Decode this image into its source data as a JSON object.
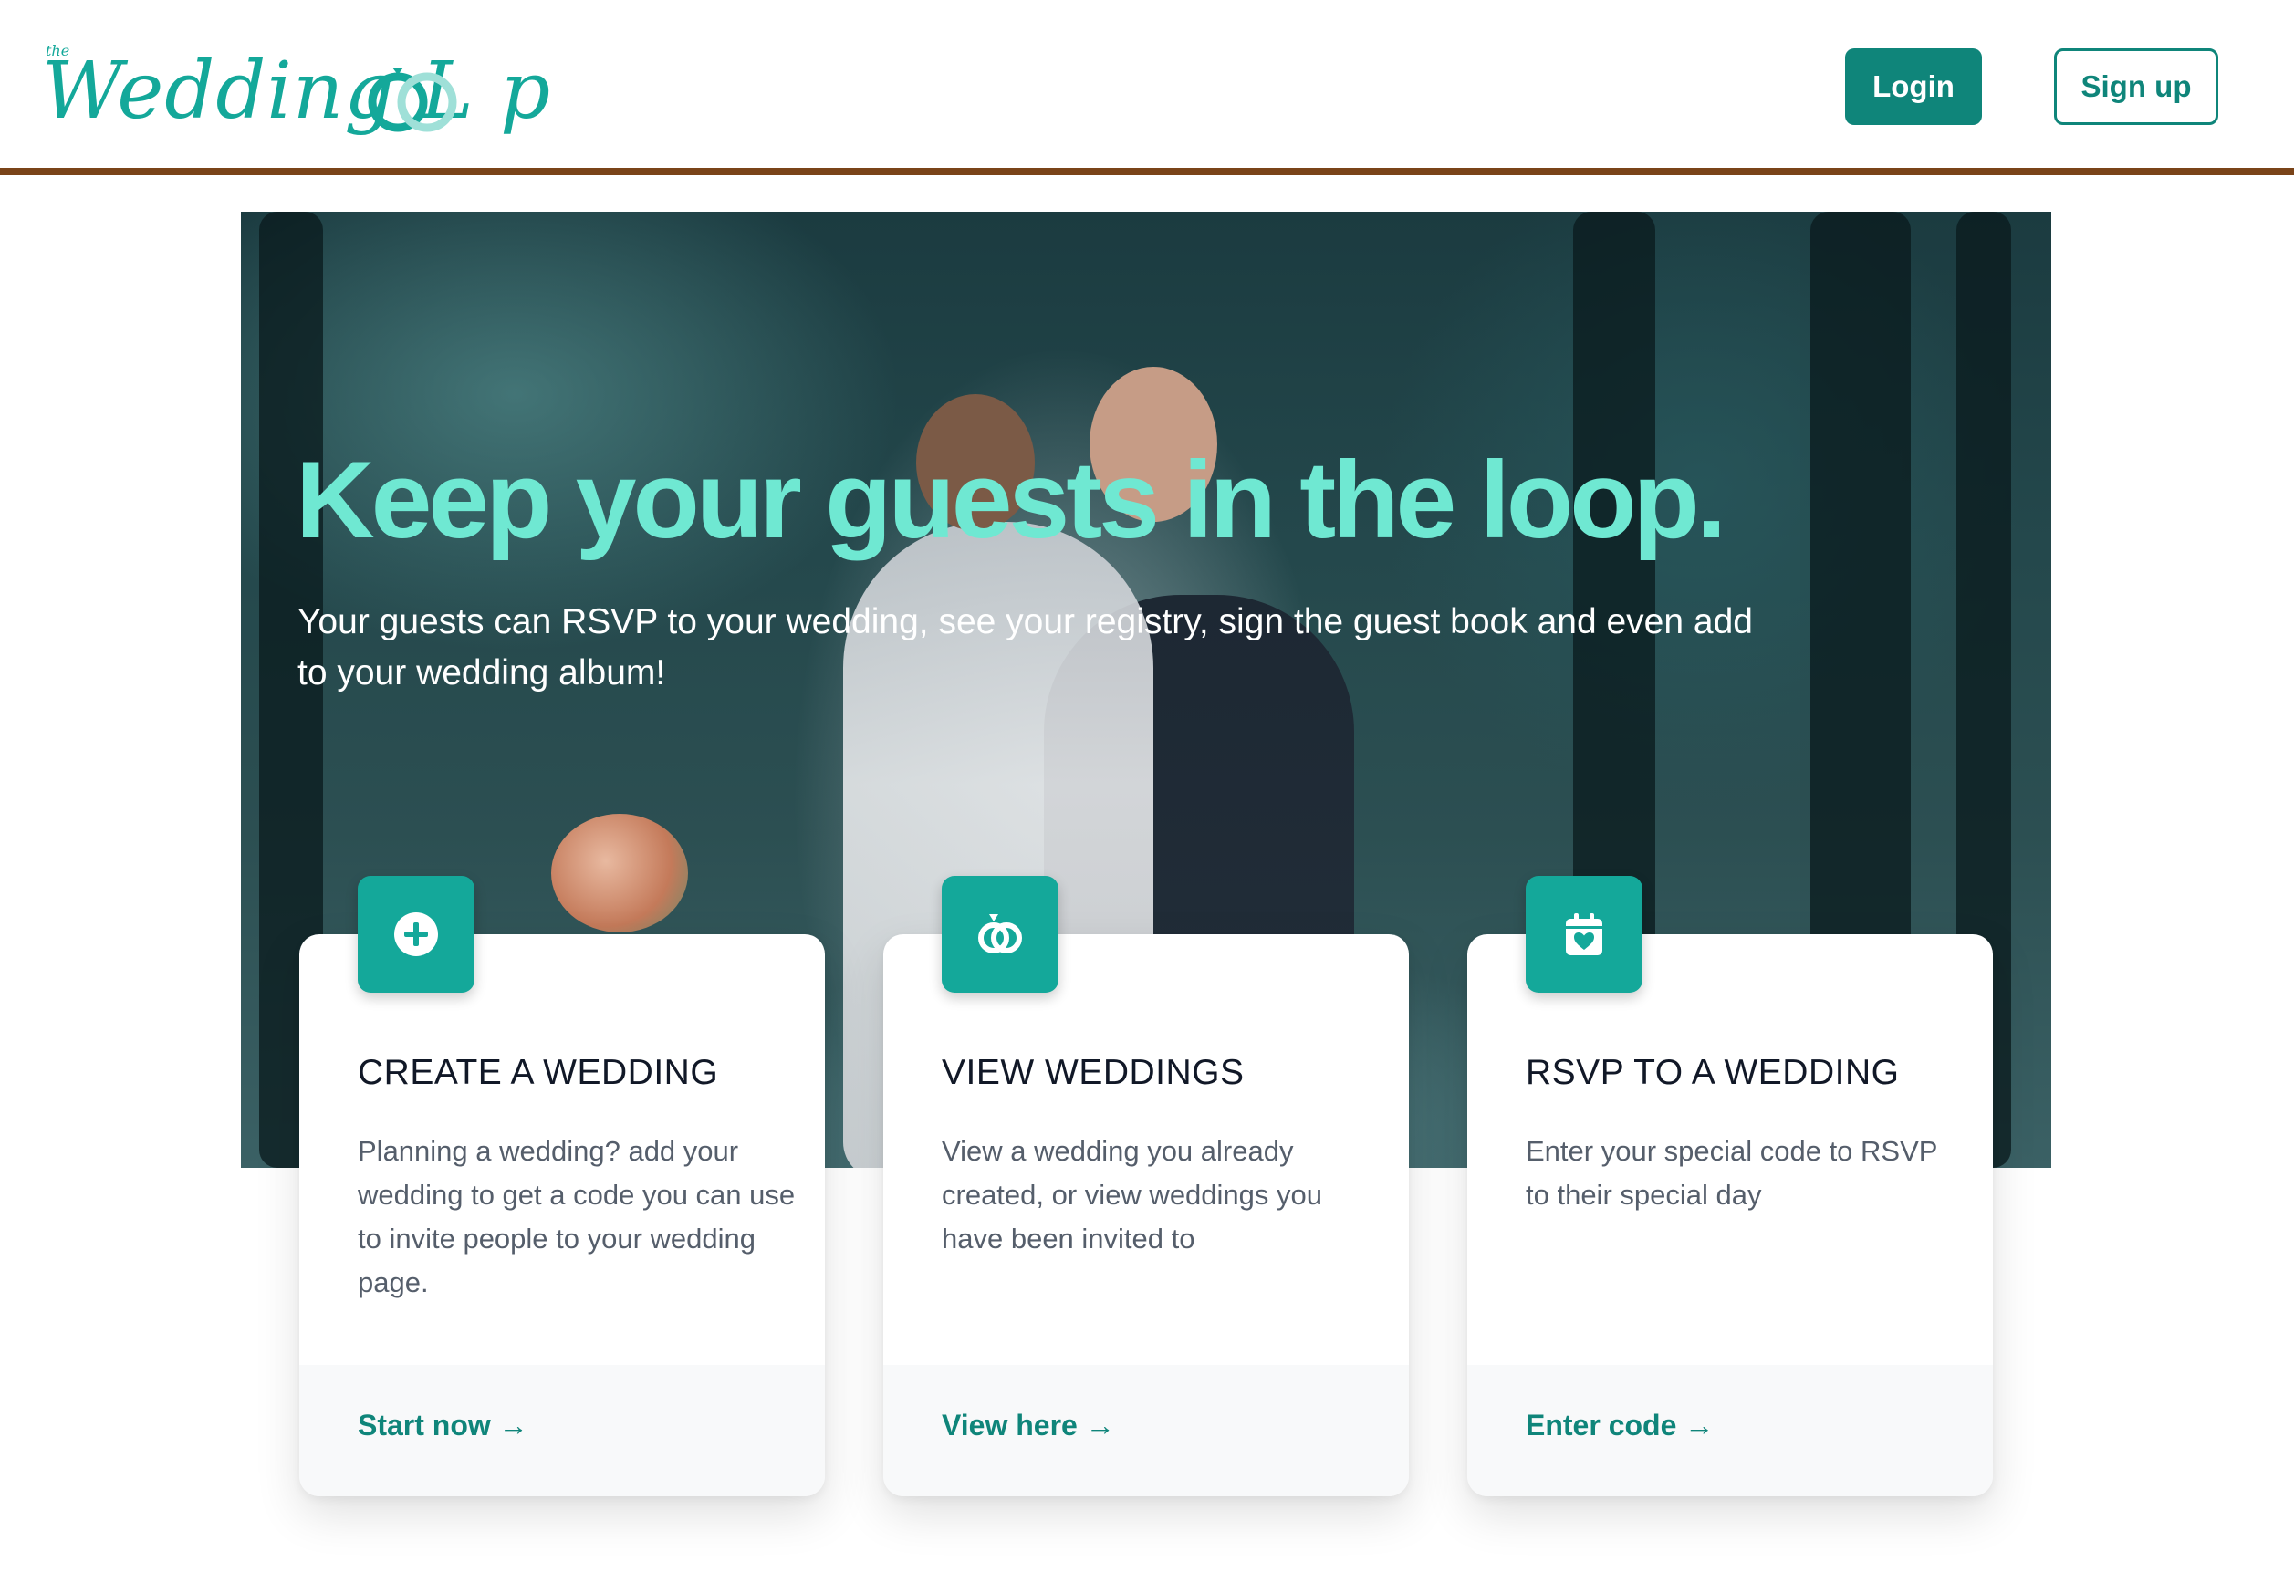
{
  "header": {
    "logo_small": "the",
    "logo_text": "Wedding L  p",
    "login_label": "Login",
    "signup_label": "Sign up"
  },
  "hero": {
    "title": "Keep your guests in the loop.",
    "subtitle": "Your guests can RSVP to your wedding, see your registry, sign the guest book and even add to your wedding album!"
  },
  "cards": [
    {
      "icon": "plus-circle-icon",
      "title": "CREATE A WEDDING",
      "description": "Planning a wedding? add your wedding to get a code you can use to invite people to your wedding page.",
      "link": "Start now →"
    },
    {
      "icon": "rings-icon",
      "title": "VIEW WEDDINGS",
      "description": "View a wedding you already created, or view weddings you have been invited to",
      "link": "View here →"
    },
    {
      "icon": "calendar-heart-icon",
      "title": "RSVP TO A WEDDING",
      "description": "Enter your special code to RSVP to their special day",
      "link": "Enter code →"
    }
  ],
  "colors": {
    "brand": "#14a89a",
    "brand_dark": "#0f857a",
    "header_border": "#7a4419",
    "hero_title": "#6fe8d2"
  }
}
